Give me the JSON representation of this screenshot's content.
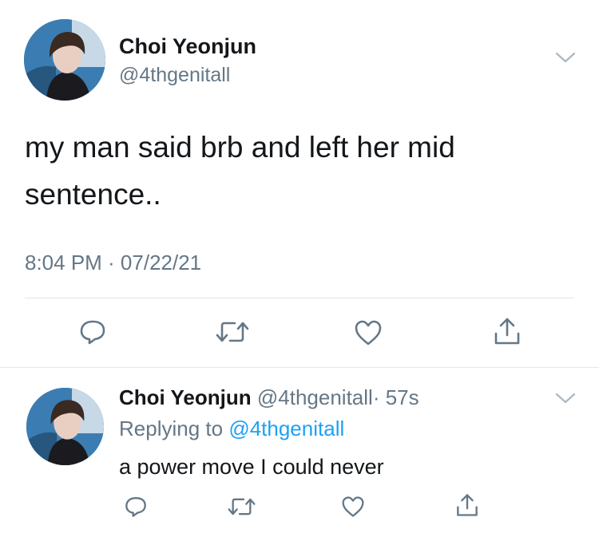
{
  "main_tweet": {
    "author_name": "Choi Yeonjun",
    "author_handle": "@4thgenitall",
    "text_line1": "my man said brb and left her mid",
    "text_line2": "sentence..",
    "timestamp": "8:04 PM · 07/22/21",
    "actions": [
      "reply-icon",
      "retweet-icon",
      "like-icon",
      "share-icon"
    ]
  },
  "reply_tweet": {
    "author_name": "Choi Yeonjun",
    "author_handle": "@4thgenitall",
    "time_ago": "· 57s",
    "replying_prefix": "Replying to",
    "replying_handle": "@4thgenitall",
    "text": "a power move I could never",
    "actions": [
      "reply-icon",
      "retweet-icon",
      "like-icon",
      "share-icon"
    ]
  },
  "colors": {
    "text": "#14171a",
    "muted": "#657786",
    "link": "#1da1f2",
    "divider": "#e1e8ed",
    "icon": "#657786"
  }
}
